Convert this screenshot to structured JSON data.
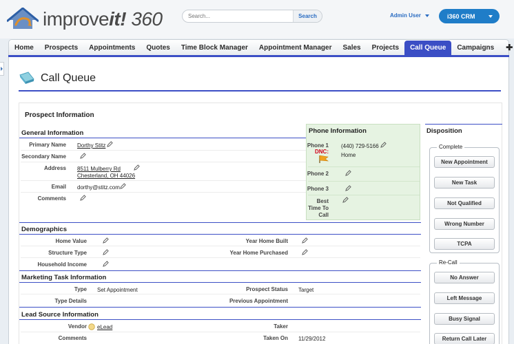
{
  "header": {
    "logo_brand": "improve",
    "logo_bang": "it!",
    "logo_num": "360",
    "search_placeholder": "Search...",
    "search_button": "Search",
    "user": "Admin User",
    "app": "i360 CRM"
  },
  "nav": {
    "tabs": [
      "Home",
      "Prospects",
      "Appointments",
      "Quotes",
      "Time Block Manager",
      "Appointment Manager",
      "Sales",
      "Projects",
      "Call Queue",
      "Campaigns"
    ],
    "active": "Call Queue"
  },
  "page": {
    "title": "Call Queue"
  },
  "prospect": {
    "title": "Prospect Information",
    "general": {
      "title": "General Information",
      "primary_name_label": "Primary Name",
      "primary_name": "Dorthy Stitz",
      "secondary_name_label": "Secondary Name",
      "address_label": "Address",
      "address_line1": "8511 Mulberry Rd",
      "address_line2": "Chesterland, OH 44026",
      "email_label": "Email",
      "email": "dorthy@stitz.com",
      "comments_label": "Comments"
    },
    "phone": {
      "title": "Phone Information",
      "phone1_label": "Phone 1",
      "dnc_label": "DNC:",
      "phone1": "(440) 729-5166",
      "phone1_type": "Home",
      "phone2_label": "Phone 2",
      "phone3_label": "Phone 3",
      "best_time_l1": "Best",
      "best_time_l2": "Time To",
      "best_time_l3": "Call"
    },
    "demographics": {
      "title": "Demographics",
      "home_value_label": "Home Value",
      "structure_type_label": "Structure Type",
      "household_income_label": "Household Income",
      "year_built_label": "Year Home Built",
      "year_purchased_label": "Year Home Purchased"
    },
    "marketing": {
      "title": "Marketing Task Information",
      "type_label": "Type",
      "type": "Set Appointment",
      "type_details_label": "Type Details",
      "prospect_status_label": "Prospect Status",
      "prospect_status": "Target",
      "previous_appt_label": "Previous Appointment"
    },
    "lead_source": {
      "title": "Lead Source Information",
      "vendor_label": "Vendor",
      "vendor": "eLead",
      "comments_label": "Comments",
      "taker_label": "Taker",
      "taken_on_label": "Taken On",
      "taken_on": "11/29/2012"
    }
  },
  "disposition": {
    "title": "Disposition",
    "complete_legend": "Complete",
    "complete_buttons": [
      "New Appointment",
      "New Task",
      "Not Qualified",
      "Wrong Number",
      "TCPA"
    ],
    "recall_legend": "Re-Call",
    "recall_buttons": [
      "No Answer",
      "Left Message",
      "Busy Signal",
      "Return Call Later"
    ]
  },
  "colors": {
    "accent": "#3b4ec5",
    "nav_active": "#3b4ec5",
    "app_button": "#1f7dc8",
    "phone_bg": "#e6f3e2",
    "dnc": "#d0021b"
  }
}
